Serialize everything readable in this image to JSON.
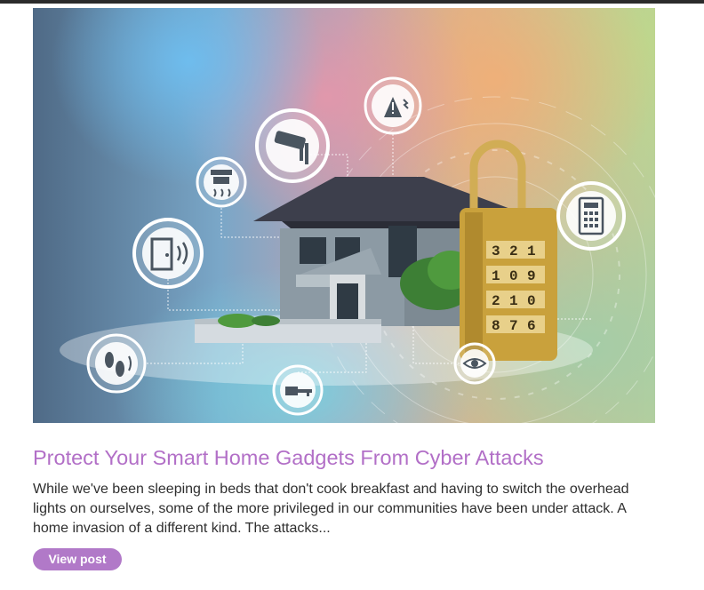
{
  "post": {
    "image": {
      "subject": "smart-home-security-illustration",
      "icons": [
        "alert-icon",
        "security-camera-icon",
        "smoke-detector-icon",
        "door-sensor-icon",
        "footsteps-icon",
        "key-icon",
        "eye-icon",
        "keypad-icon",
        "padlock-icon"
      ],
      "padlock_digits": [
        [
          "3",
          "2",
          "1"
        ],
        [
          "1",
          "0",
          "9"
        ],
        [
          "2",
          "1",
          "0"
        ],
        [
          "8",
          "7",
          "6"
        ]
      ],
      "colors": {
        "sky_left": "#6fb8e6",
        "sky_mid": "#e49db0",
        "sky_right": "#d7d892",
        "house_roof": "#3d3f4c",
        "house_wall": "#8c9aa4",
        "lock_gold": "#c9a13c"
      }
    },
    "title": "Protect Your Smart Home Gadgets From Cyber Attacks",
    "excerpt": "While we've been sleeping in beds that don't cook breakfast and having to switch the overhead lights on ourselves, some of the more privileged in our communities have been under attack. A home invasion of a different kind. The attacks...",
    "button_label": "View post",
    "colors": {
      "title": "#b26fc7",
      "button_bg": "#b179c8",
      "button_text": "#ffffff",
      "body_text": "#2f2f2f"
    }
  }
}
